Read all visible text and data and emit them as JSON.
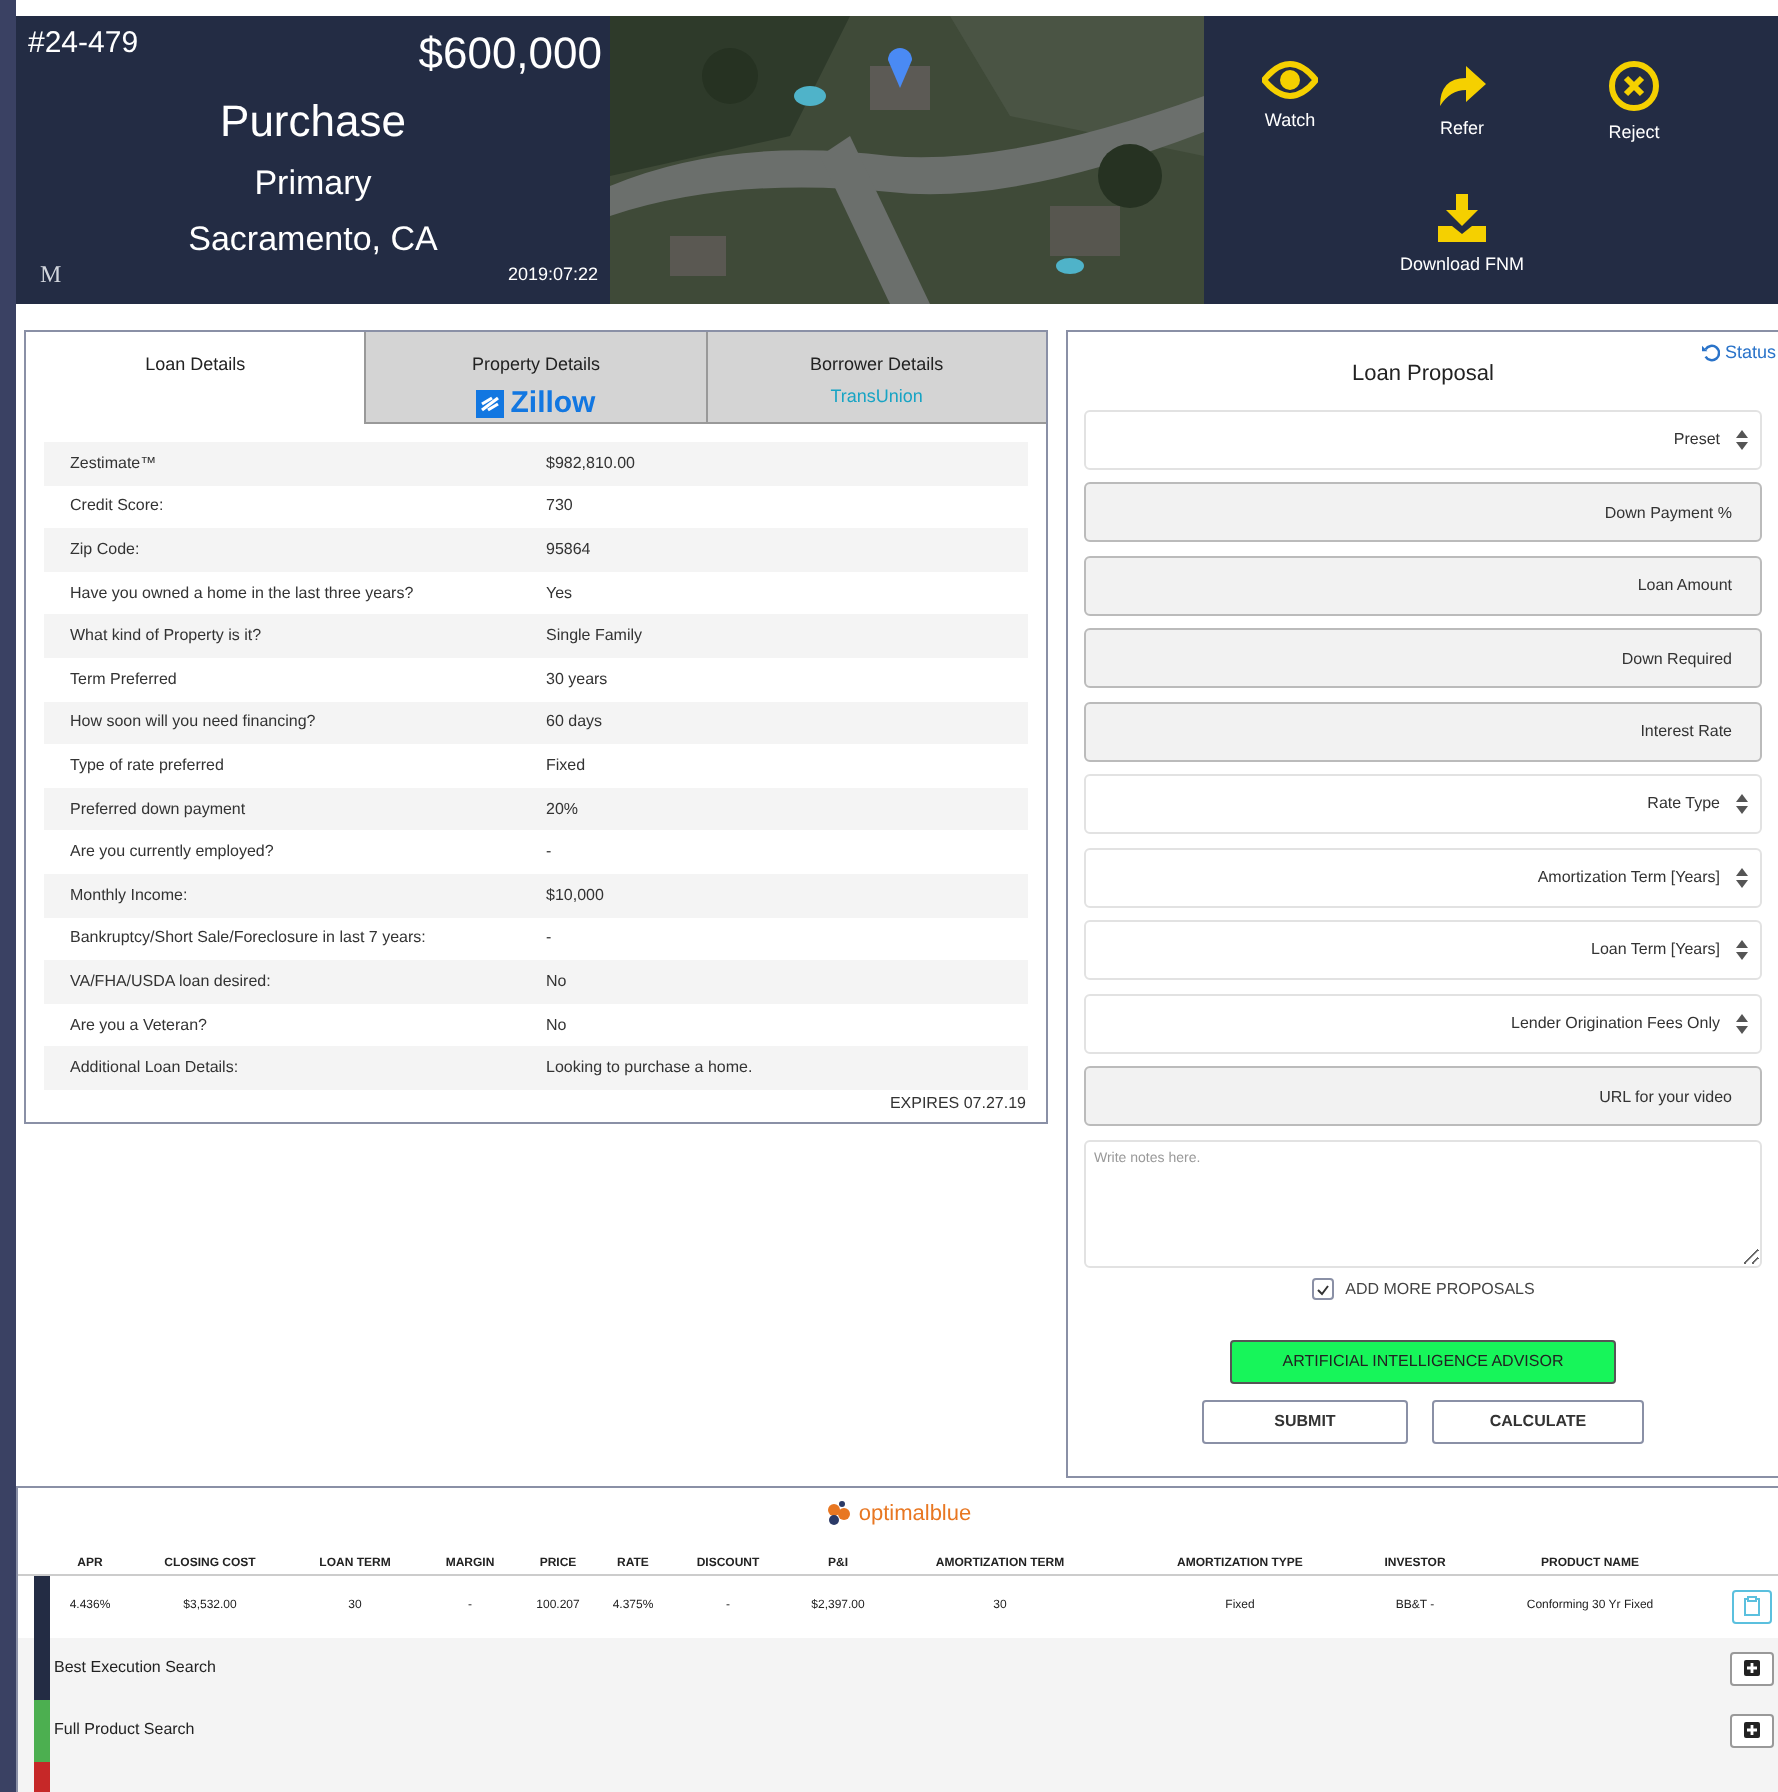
{
  "header": {
    "id": "#24-479",
    "price": "$600,000",
    "purpose": "Purchase",
    "occupancy": "Primary",
    "location": "Sacramento, CA",
    "logo": "M",
    "date": "2019:07:22",
    "actions": [
      {
        "kind": "watch",
        "label": "Watch"
      },
      {
        "kind": "refer",
        "label": "Refer"
      },
      {
        "kind": "reject",
        "label": "Reject"
      },
      {
        "kind": "download",
        "label": "Download FNM"
      }
    ]
  },
  "tabs": [
    {
      "label": "Loan Details",
      "selected": true
    },
    {
      "label": "Property Details",
      "logo": "Zillow",
      "kind": "zillow",
      "selected": false
    },
    {
      "label": "Borrower Details",
      "logo": "TransUnion",
      "kind": "transunion",
      "selected": false
    }
  ],
  "details": [
    {
      "label": "Zestimate™",
      "value": "$982,810.00"
    },
    {
      "label": "Credit Score:",
      "value": "730"
    },
    {
      "label": "Zip Code:",
      "value": "95864"
    },
    {
      "label": "Have you owned a home in the last three years?",
      "value": "Yes"
    },
    {
      "label": "What kind of Property is it?",
      "value": "Single Family"
    },
    {
      "label": "Term Preferred",
      "value": "30 years"
    },
    {
      "label": "How soon will you need financing?",
      "value": "60 days"
    },
    {
      "label": "Type of rate preferred",
      "value": "Fixed"
    },
    {
      "label": "Preferred down payment",
      "value": "20%"
    },
    {
      "label": "Are you currently employed?",
      "value": "-"
    },
    {
      "label": "Monthly Income:",
      "value": "$10,000"
    },
    {
      "label": "Bankruptcy/Short Sale/Foreclosure in last 7 years:",
      "value": "-"
    },
    {
      "label": "VA/FHA/USDA loan desired:",
      "value": "No"
    },
    {
      "label": "Are you a Veteran?",
      "value": "No"
    },
    {
      "label": "Additional Loan Details:",
      "value": "Looking to purchase a home."
    }
  ],
  "expires": "EXPIRES 07.27.19",
  "proposal": {
    "title": "Loan Proposal",
    "status_link": "Status",
    "fields": [
      {
        "kind": "select",
        "label": "Preset"
      },
      {
        "kind": "input",
        "placeholder": "Down Payment %"
      },
      {
        "kind": "input",
        "placeholder": "Loan Amount"
      },
      {
        "kind": "input",
        "placeholder": "Down Required"
      },
      {
        "kind": "input",
        "placeholder": "Interest Rate"
      },
      {
        "kind": "select",
        "label": "Rate Type"
      },
      {
        "kind": "select",
        "label": "Amortization Term [Years]"
      },
      {
        "kind": "select",
        "label": "Loan Term [Years]"
      },
      {
        "kind": "select",
        "label": "Lender Origination Fees Only"
      },
      {
        "kind": "input",
        "placeholder": "URL for your video"
      }
    ],
    "notes_placeholder": "Write notes here.",
    "add_more": {
      "label": "ADD MORE PROPOSALS",
      "checked": true
    },
    "ai_button": "ARTIFICIAL INTELLIGENCE ADVISOR",
    "submit": "SUBMIT",
    "calculate": "CALCULATE"
  },
  "results": {
    "brand": "optimalblue",
    "columns": [
      "APR",
      "CLOSING COST",
      "LOAN TERM",
      "MARGIN",
      "PRICE",
      "RATE",
      "DISCOUNT",
      "P&I",
      "AMORTIZATION TERM",
      "AMORTIZATION TYPE",
      "INVESTOR",
      "PRODUCT NAME"
    ],
    "rows": [
      {
        "color": "#232c44",
        "cells": [
          "4.436%",
          "$3,532.00",
          "30",
          "-",
          "100.207",
          "4.375%",
          "-",
          "$2,397.00",
          "30",
          "Fixed",
          "BB&T -",
          "Conforming 30 Yr Fixed"
        ]
      }
    ],
    "searches": [
      {
        "label": "Best Execution Search",
        "color": "#232c44"
      },
      {
        "label": "Full Product Search",
        "color": "#4caf50"
      },
      {
        "color": "#c62828"
      }
    ]
  }
}
